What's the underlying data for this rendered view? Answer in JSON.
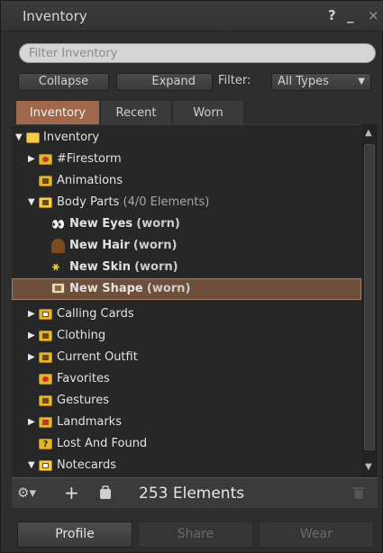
{
  "window": {
    "title": "Inventory",
    "help": "?",
    "minimize": "_",
    "close": "×"
  },
  "filter": {
    "placeholder": "Filter Inventory"
  },
  "actions": {
    "collapse": "Collapse",
    "expand": "Expand",
    "filter_label": "Filter:",
    "filter_value": "All Types"
  },
  "tabs": [
    {
      "label": "Inventory",
      "active": true
    },
    {
      "label": "Recent",
      "active": false
    },
    {
      "label": "Worn",
      "active": false
    }
  ],
  "tree": {
    "root": "Inventory",
    "items": [
      {
        "label": "#Firestorm",
        "icon": "firestorm-folder-icon"
      },
      {
        "label": "Animations",
        "icon": "animations-folder-icon"
      },
      {
        "label": "Body Parts",
        "note": "(4/0 Elements)",
        "icon": "body-parts-folder-icon"
      },
      {
        "label": "New Eyes",
        "worn": "(worn)",
        "icon": "eyes-icon"
      },
      {
        "label": "New Hair",
        "worn": "(worn)",
        "icon": "hair-icon"
      },
      {
        "label": "New Skin",
        "worn": "(worn)",
        "icon": "skin-icon"
      },
      {
        "label": "New Shape",
        "worn": "(worn)",
        "icon": "shape-icon",
        "selected": true
      },
      {
        "label": "Calling Cards",
        "icon": "calling-cards-folder-icon"
      },
      {
        "label": "Clothing",
        "icon": "clothing-folder-icon"
      },
      {
        "label": "Current Outfit",
        "icon": "current-outfit-folder-icon"
      },
      {
        "label": "Favorites",
        "icon": "favorites-folder-icon"
      },
      {
        "label": "Gestures",
        "icon": "gestures-folder-icon"
      },
      {
        "label": "Landmarks",
        "icon": "landmarks-folder-icon"
      },
      {
        "label": "Lost And Found",
        "icon": "lost-and-found-folder-icon"
      },
      {
        "label": "Notecards",
        "icon": "notecards-folder-icon"
      }
    ]
  },
  "toolbar": {
    "count": "253 Elements"
  },
  "buttons": {
    "profile": "Profile",
    "share": "Share",
    "wear": "Wear"
  },
  "colors": {
    "accent_tab": "#a0674a",
    "selection": "#6e4f3c",
    "folder": "#e2b52a"
  }
}
